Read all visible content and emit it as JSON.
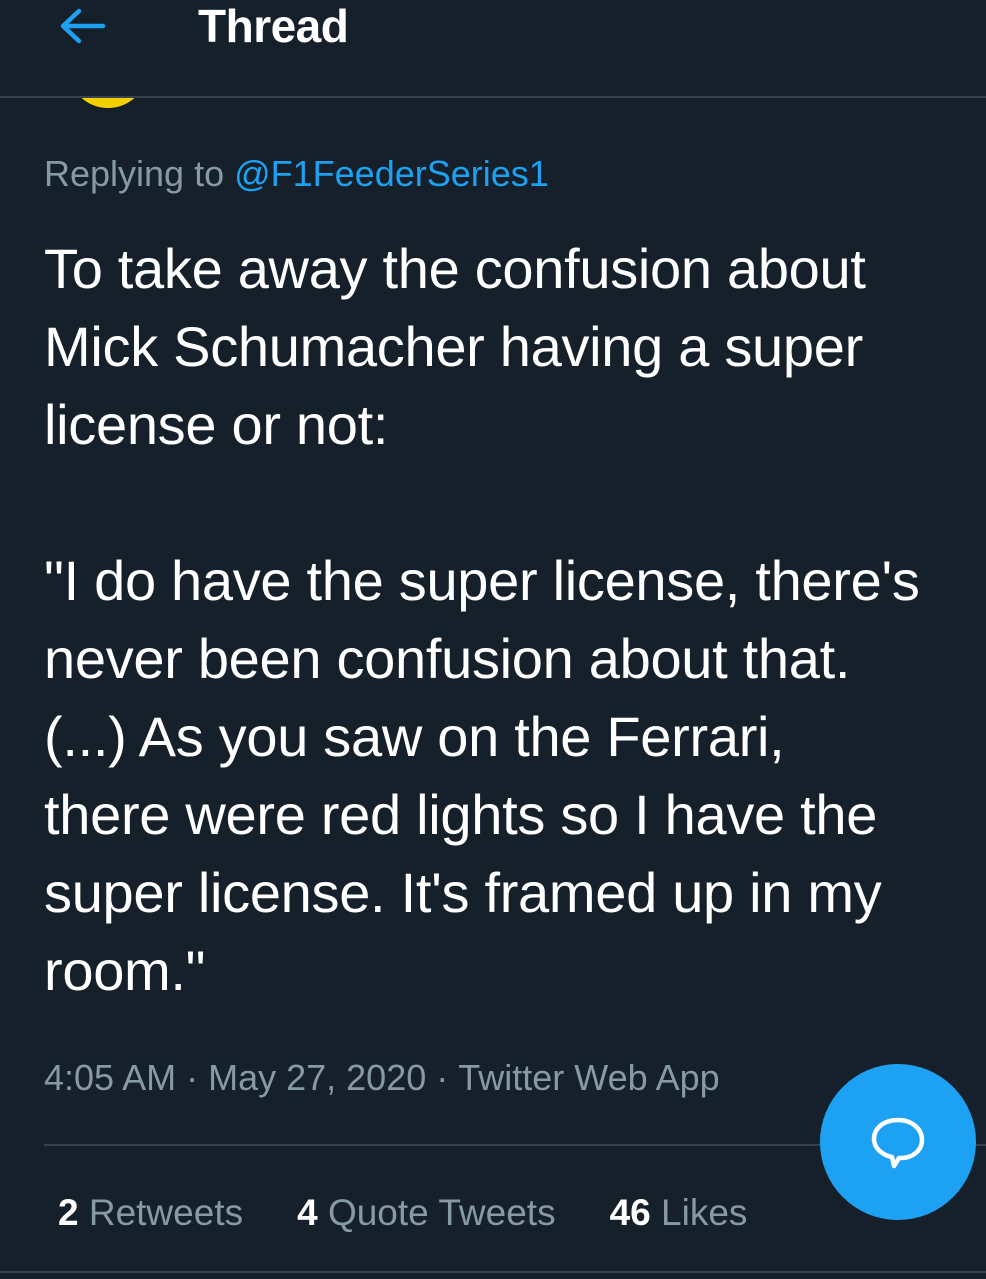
{
  "header": {
    "back_icon": "arrow-left-icon",
    "title": "Thread"
  },
  "tweet": {
    "replying_prefix": "Replying to ",
    "replying_handle": "@F1FeederSeries1",
    "text": "To take away the confusion about\nMick Schumacher having a super\nlicense or not:\n\n\"I do have the super license, there's\nnever been confusion about that.\n(...) As you saw on the Ferrari,\nthere were red lights so I have the\nsuper license. It's framed up in my\nroom.\"",
    "time": "4:05 AM",
    "date": "May 27, 2020",
    "source": "Twitter Web App",
    "separator": "·"
  },
  "stats": {
    "retweets_count": "2",
    "retweets_label": "Retweets",
    "quotes_count": "4",
    "quotes_label": "Quote Tweets",
    "likes_count": "46",
    "likes_label": "Likes"
  },
  "fab": {
    "icon": "reply-bubble-icon"
  },
  "colors": {
    "background": "#15202b",
    "accent": "#1da1f2",
    "secondary_text": "#8899a6",
    "divider": "#38444d",
    "avatar": "#f5d000"
  }
}
